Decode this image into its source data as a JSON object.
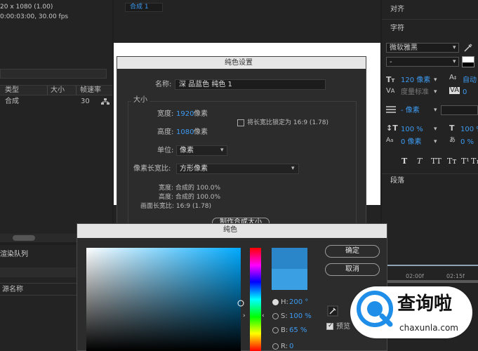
{
  "project": {
    "comp_info_1": "20 x 1080 (1.00)",
    "comp_info_2": "0:00:03:00, 30.00 fps",
    "columns": [
      "类型",
      "大小",
      "帧速率"
    ],
    "row": {
      "type": "合成",
      "fps": "30"
    }
  },
  "render_queue": {
    "title": "渲染队列",
    "source_name": "源名称"
  },
  "comp_tab": "合成 1",
  "right_panel": {
    "align_label": "对齐",
    "char_label": "字符",
    "font_family": "微软雅黑",
    "font_style": "-",
    "font_size": "120 像素",
    "leading_auto": "自动",
    "tracking_hint": "度量标准",
    "kerning_value": "0",
    "stroke_width": "- 像素",
    "vertical_scale": "100 %",
    "horizontal_scale": "100 %",
    "baseline_shift": "0 像素",
    "tsume": "0 %",
    "style_buttons": [
      "T",
      "T",
      "TT",
      "Tт",
      "T¹",
      "T₁"
    ],
    "paragraph_label": "段落"
  },
  "solid_settings": {
    "title": "纯色设置",
    "name_label": "名称:",
    "name_value": "深 品蓝色 纯色 1",
    "size_label": "大小",
    "width_label": "宽度:",
    "width_value": "1920",
    "height_label": "高度:",
    "height_value": "1080",
    "pixel_unit": "像素",
    "lock_label": "将长宽比锁定为 16:9 (1.78)",
    "units_label": "单位:",
    "units_value": "像素",
    "par_label": "像素长宽比:",
    "par_value": "方形像素",
    "info_lines": [
      "宽度: 合成的 100.0%",
      "高度: 合成的 100.0%",
      "画面长宽比: 16:9 (1.78)"
    ],
    "make_comp_size": "制作合成大小"
  },
  "solid_color": {
    "title": "纯色",
    "ok": "确定",
    "cancel": "取消",
    "h_label": "H:",
    "h_value": "200 °",
    "s_label": "S:",
    "s_value": "100 %",
    "b_label": "B:",
    "b_value": "65 %",
    "r_label": "R:",
    "r_value": "0",
    "preview_label": "预览",
    "new_color": "#2a86c9",
    "old_color": "#3aa0e3"
  },
  "timeline": {
    "marks": [
      "02:00f",
      "02:15f"
    ]
  },
  "watermark": {
    "brand": "查询啦",
    "url": "chaxunla.com"
  }
}
